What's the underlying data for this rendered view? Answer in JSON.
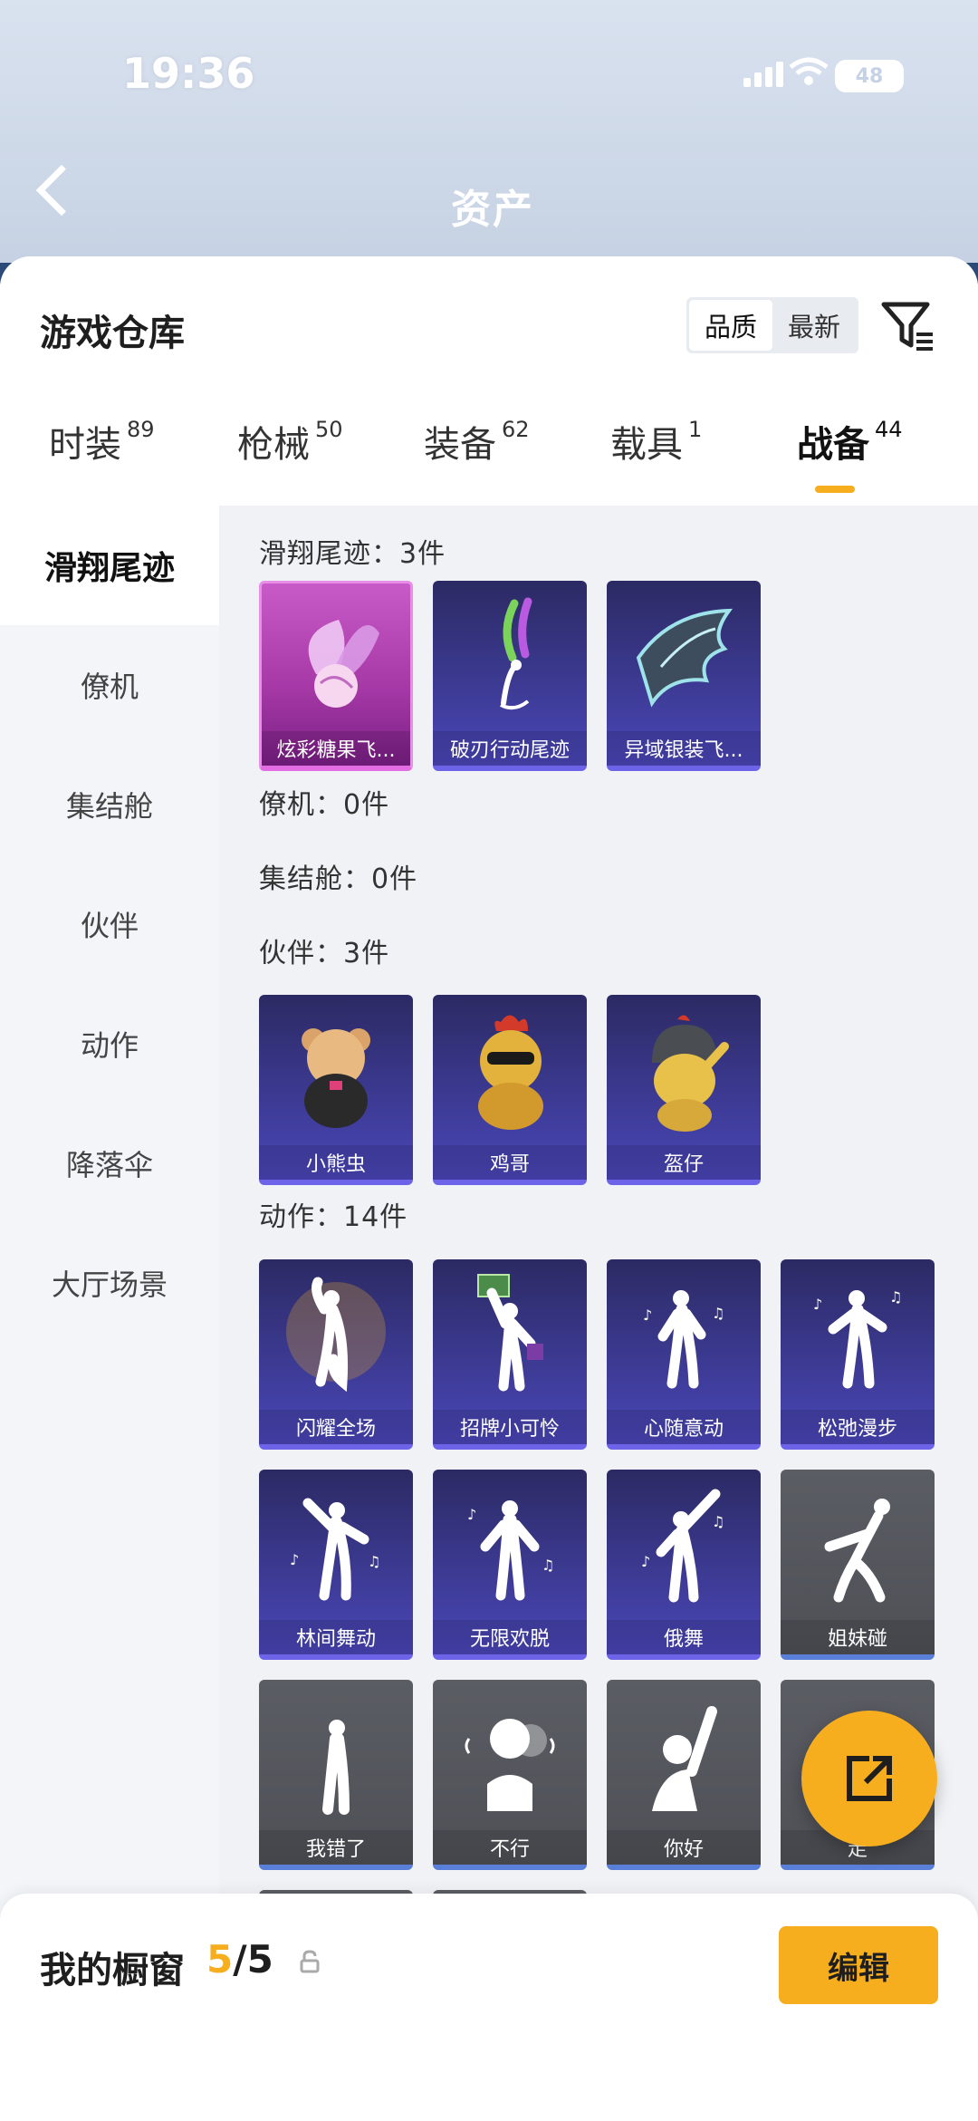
{
  "status_bar": {
    "time": "19:36",
    "battery": "48"
  },
  "nav": {
    "title": "资产"
  },
  "header": {
    "title": "游戏仓库",
    "sort_options": [
      "品质",
      "最新"
    ]
  },
  "tabs": [
    {
      "label": "时装",
      "count": "89"
    },
    {
      "label": "枪械",
      "count": "50"
    },
    {
      "label": "装备",
      "count": "62"
    },
    {
      "label": "载具",
      "count": "1"
    },
    {
      "label": "战备",
      "count": "44"
    }
  ],
  "sidebar": {
    "items": [
      {
        "label": "滑翔尾迹"
      },
      {
        "label": "僚机"
      },
      {
        "label": "集结舱"
      },
      {
        "label": "伙伴"
      },
      {
        "label": "动作"
      },
      {
        "label": "降落伞"
      },
      {
        "label": "大厅场景"
      }
    ]
  },
  "sections": {
    "glide": {
      "title": "滑翔尾迹：3件",
      "items": [
        "炫彩糖果飞...",
        "破刃行动尾迹",
        "异域银装飞..."
      ]
    },
    "wingman": {
      "title": "僚机：0件"
    },
    "pod": {
      "title": "集结舱：0件"
    },
    "partner": {
      "title": "伙伴：3件",
      "items": [
        "小熊虫",
        "鸡哥",
        "盔仔"
      ]
    },
    "emote": {
      "title": "动作：14件",
      "items": [
        "闪耀全场",
        "招牌小可怜",
        "心随意动",
        "松弛漫步",
        "林间舞动",
        "无限欢脱",
        "俄舞",
        "姐妹碰",
        "我错了",
        "不行",
        "你好",
        "走"
      ]
    }
  },
  "showcase": {
    "label": "我的橱窗",
    "current": "5",
    "total": "/5",
    "edit_label": "编辑"
  },
  "colors": {
    "accent": "#f6ae1f",
    "card_purple": "#3c3a92",
    "card_pink": "#a83aa8",
    "card_gray": "#54565c"
  }
}
